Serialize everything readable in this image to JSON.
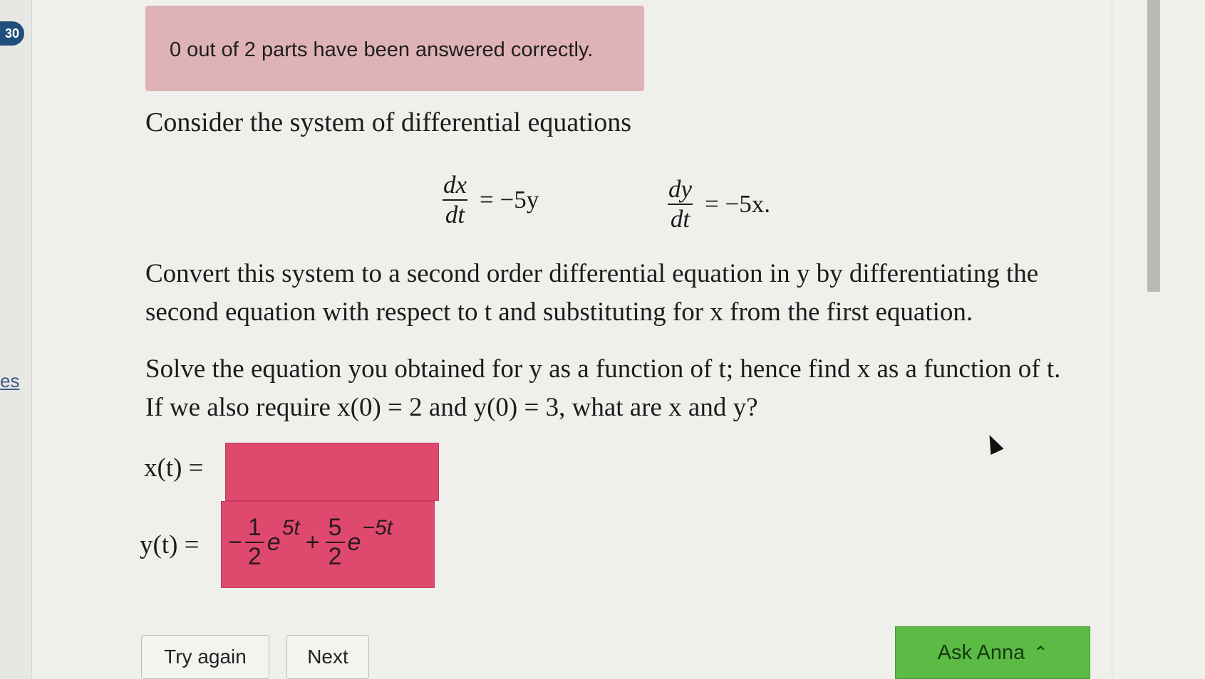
{
  "sidebar": {
    "question_number": "30",
    "link_fragment": "es"
  },
  "feedback": {
    "message": "0 out of 2 parts have been answered correctly."
  },
  "problem": {
    "intro": "Consider the system of differential equations",
    "eq1": {
      "num": "dx",
      "den": "dt",
      "rhs": "= −5y"
    },
    "eq2": {
      "num": "dy",
      "den": "dt",
      "rhs": "= −5x."
    },
    "para1": "Convert this system to a second order differential equation in y by differentiating the second equation with respect to t and substituting for x from the first equation.",
    "para2": "Solve the equation you obtained for y as a function of t; hence find x as a function of t. If we also require x(0) = 2 and y(0) = 3, what are x and y?"
  },
  "answers": {
    "x_label": "x(t) =",
    "x_value": "",
    "y_label": "y(t) =",
    "y_value": {
      "sign": "−",
      "frac1_num": "1",
      "frac1_den": "2",
      "base1": "e",
      "exp1": "5t",
      "plus": "+",
      "frac2_num": "5",
      "frac2_den": "2",
      "base2": "e",
      "exp2": "−5t"
    },
    "status_color": "#e0496e"
  },
  "buttons": {
    "try_again": "Try again",
    "next": "Next",
    "ask": "Ask Anna"
  },
  "icons": {
    "ask_chevron": "chevron-up-icon"
  }
}
